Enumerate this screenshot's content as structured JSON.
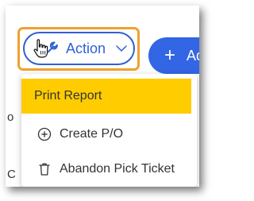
{
  "toolbar": {
    "action_label": "Action",
    "add_label": "Ad",
    "add_symbol": "+"
  },
  "background": {
    "fragment_a": "o",
    "fragment_b": "C"
  },
  "menu": {
    "items": [
      {
        "label": "Print Report",
        "icon": "none",
        "highlighted": true
      },
      {
        "label": "Create P/O",
        "icon": "plus-circle-icon",
        "highlighted": false
      },
      {
        "label": "Abandon Pick Ticket",
        "icon": "trash-icon",
        "highlighted": false
      }
    ]
  },
  "colors": {
    "accent": "#2f5fd8",
    "add_button": "#3366e4",
    "focus_ring": "#f0a12e",
    "highlight": "#ffcc00"
  }
}
